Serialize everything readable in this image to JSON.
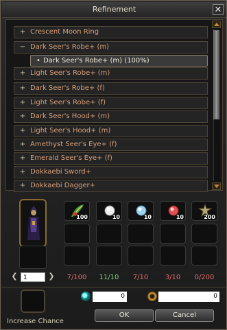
{
  "window": {
    "title": "Refinement",
    "close_label": "✕"
  },
  "list": {
    "items": [
      {
        "sign": "+",
        "label": "Crescent Moon Ring"
      },
      {
        "sign": "−",
        "label": "Dark Seer's Robe+ (m)"
      },
      {
        "sign": "+",
        "label": "Light Seer's Robe+ (m)"
      },
      {
        "sign": "+",
        "label": "Dark Seer's Robe+ (f)"
      },
      {
        "sign": "+",
        "label": "Light Seer's Robe+ (f)"
      },
      {
        "sign": "+",
        "label": "Dark Seer's Hood+ (m)"
      },
      {
        "sign": "+",
        "label": "Light Seer's Hood+ (m)"
      },
      {
        "sign": "+",
        "label": "Amethyst Seer's Eye+ (f)"
      },
      {
        "sign": "+",
        "label": "Emerald Seer's Eye+ (f)"
      },
      {
        "sign": "+",
        "label": "Dokkaebi Sword+"
      },
      {
        "sign": "+",
        "label": "Dokkaebi Dagger+"
      }
    ],
    "sub_item": {
      "bullet": "•",
      "label": "Dark Seer's Robe+ (m) (100%)"
    }
  },
  "materials": [
    {
      "icon": "feather-leaf-icon",
      "qty": "100",
      "count": "7/100",
      "count_color": "#e06a6a"
    },
    {
      "icon": "white-orb-icon",
      "qty": "10",
      "count": "11/10",
      "count_color": "#7ed07e"
    },
    {
      "icon": "blue-orb-icon",
      "qty": "10",
      "count": "7/10",
      "count_color": "#e06a6a"
    },
    {
      "icon": "red-orb-icon",
      "qty": "10",
      "count": "3/10",
      "count_color": "#e06a6a"
    },
    {
      "icon": "star-ore-icon",
      "qty": "200",
      "count": "0/200",
      "count_color": "#e06a6a"
    }
  ],
  "pager": {
    "prev": "❮",
    "next": "❯",
    "value": "1"
  },
  "chance": {
    "label": "Increase Chance"
  },
  "currency": {
    "gem_value": "0",
    "coin_value": "0"
  },
  "buttons": {
    "ok": "OK",
    "cancel": "Cancel"
  }
}
